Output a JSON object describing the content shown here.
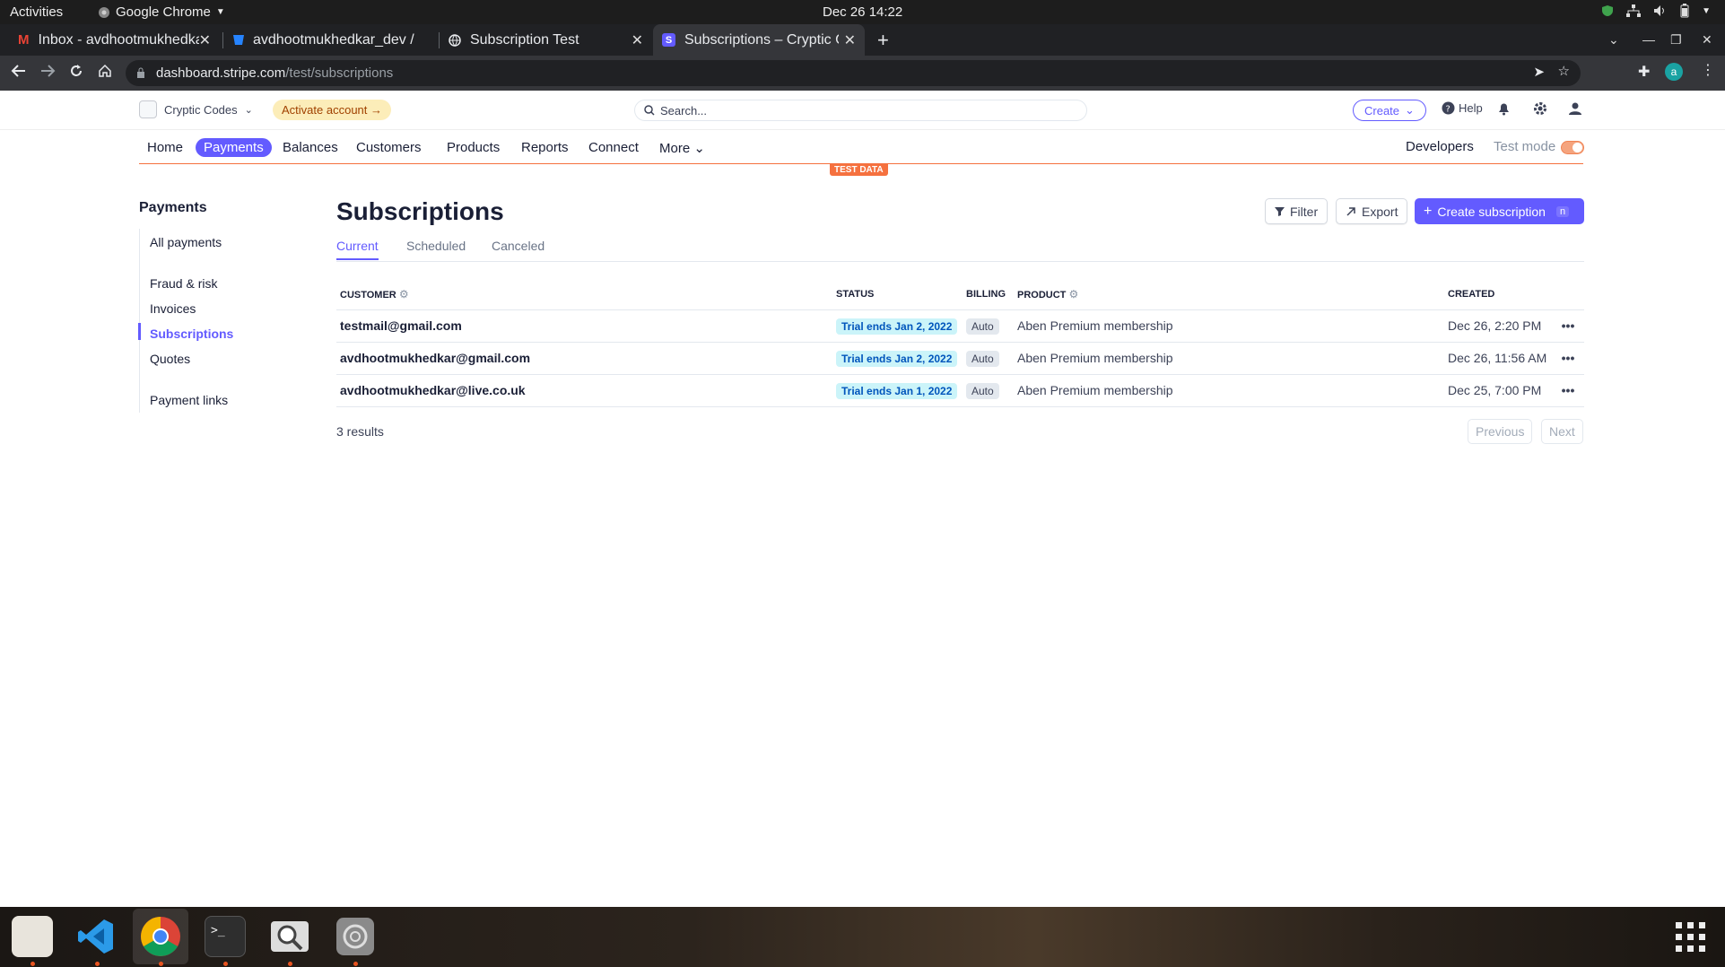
{
  "system": {
    "activities": "Activities",
    "app": "Google Chrome",
    "clock": "Dec 26  14:22"
  },
  "tabs": [
    {
      "title": "Inbox - avdhootmukhedkar"
    },
    {
      "title": "avdhootmukhedkar_dev / "
    },
    {
      "title": "Subscription Test"
    },
    {
      "title": "Subscriptions – Cryptic Codes"
    }
  ],
  "url": {
    "host": "dashboard.stripe.com",
    "path": "/test/subscriptions"
  },
  "header": {
    "account": "Cryptic Codes",
    "activate": "Activate account",
    "search_placeholder": "Search...",
    "create": "Create",
    "help": "Help"
  },
  "nav": {
    "items": [
      "Home",
      "Payments",
      "Balances",
      "Customers",
      "Products",
      "Reports",
      "Connect",
      "More"
    ],
    "developers": "Developers",
    "test_mode": "Test mode",
    "test_data": "TEST DATA"
  },
  "sidebar": {
    "title": "Payments",
    "items": [
      "All payments",
      "Fraud & risk",
      "Invoices",
      "Subscriptions",
      "Quotes",
      "Payment links"
    ]
  },
  "page": {
    "title": "Subscriptions",
    "filter": "Filter",
    "export": "Export",
    "create": "Create subscription",
    "create_key": "n",
    "tabs": [
      "Current",
      "Scheduled",
      "Canceled"
    ],
    "columns": {
      "customer": "CUSTOMER",
      "status": "STATUS",
      "billing": "BILLING",
      "product": "PRODUCT",
      "created": "CREATED"
    },
    "rows": [
      {
        "customer": "testmail@gmail.com",
        "status": "Trial ends Jan 2, 2022",
        "billing": "Auto",
        "product": "Aben Premium membership",
        "created": "Dec 26, 2:20 PM"
      },
      {
        "customer": "avdhootmukhedkar@gmail.com",
        "status": "Trial ends Jan 2, 2022",
        "billing": "Auto",
        "product": "Aben Premium membership",
        "created": "Dec 26, 11:56 AM"
      },
      {
        "customer": "avdhootmukhedkar@live.co.uk",
        "status": "Trial ends Jan 1, 2022",
        "billing": "Auto",
        "product": "Aben Premium membership",
        "created": "Dec 25, 7:00 PM"
      }
    ],
    "results": "3 results",
    "previous": "Previous",
    "next": "Next"
  },
  "colors": {
    "accent": "#635bff",
    "test": "#f5713f"
  }
}
